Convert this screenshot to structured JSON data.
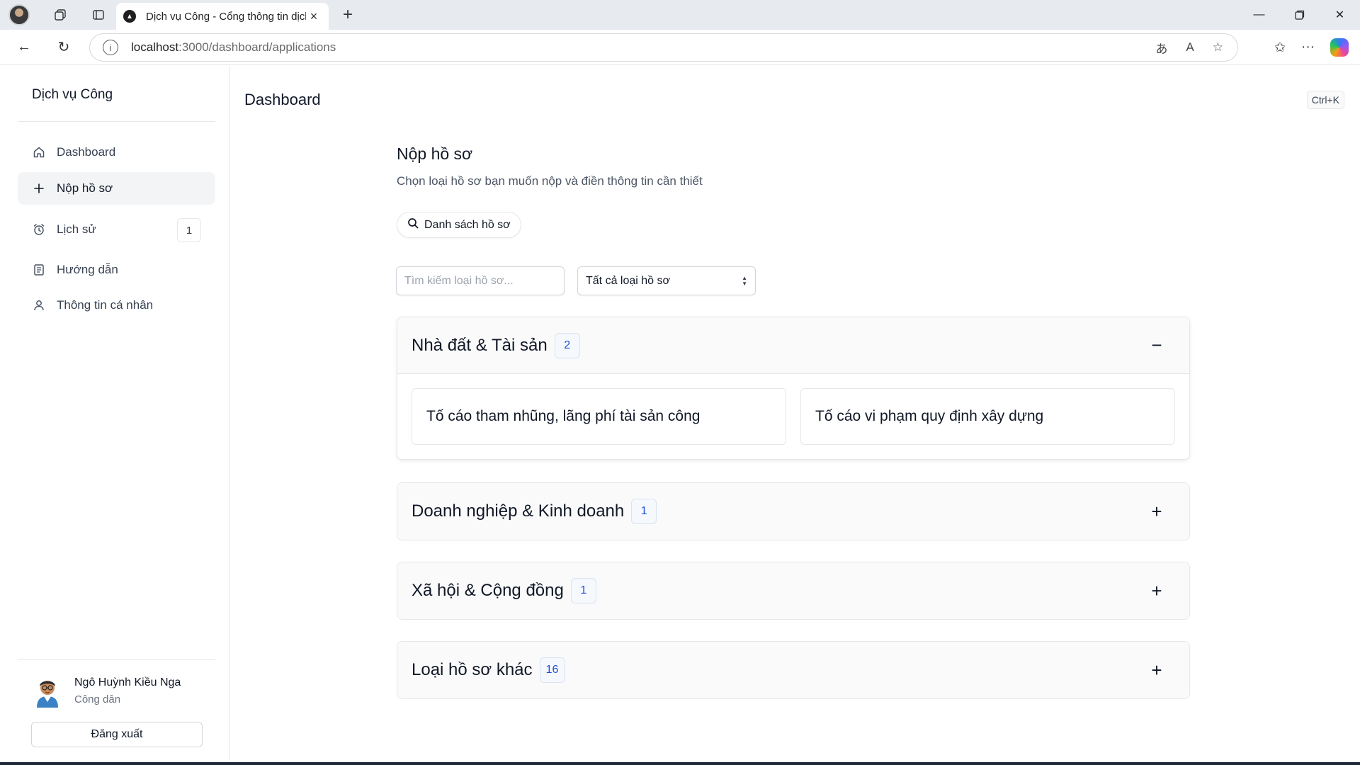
{
  "browser": {
    "tab_title": "Dịch vụ Công - Cổng thông tin dịch vụ công",
    "url_host": "localhost",
    "url_path": ":3000/dashboard/applications"
  },
  "sidebar": {
    "brand": "Dịch vụ Công",
    "items": [
      {
        "label": "Dashboard",
        "icon": "home-icon"
      },
      {
        "label": "Nộp hồ sơ",
        "icon": "plus-icon",
        "active": true
      },
      {
        "label": "Lịch sử",
        "icon": "alarm-clock-icon",
        "badge": "1"
      },
      {
        "label": "Hướng dẫn",
        "icon": "book-icon"
      },
      {
        "label": "Thông tin cá nhân",
        "icon": "user-icon"
      }
    ],
    "user": {
      "name": "Ngô Huỳnh Kiều Nga",
      "role": "Công dân"
    },
    "logout_label": "Đăng xuất"
  },
  "header": {
    "title": "Dashboard",
    "shortcut": "Ctrl+K"
  },
  "main": {
    "title": "Nộp hồ sơ",
    "subtitle": "Chọn loại hồ sơ bạn muốn nộp và điền thông tin cần thiết",
    "list_button": "Danh sách hồ sơ",
    "search_placeholder": "Tìm kiếm loại hồ sơ...",
    "type_filter": "Tất cả loại hồ sơ",
    "categories": [
      {
        "title": "Nhà đất & Tài sản",
        "count": "2",
        "toggle": "−",
        "open": true,
        "items": [
          "Tố cáo tham nhũng, lãng phí tài sản công",
          "Tố cáo vi phạm quy định xây dựng"
        ]
      },
      {
        "title": "Doanh nghiệp & Kinh doanh",
        "count": "1",
        "toggle": "+"
      },
      {
        "title": "Xã hội & Cộng đồng",
        "count": "1",
        "toggle": "+"
      },
      {
        "title": "Loại hồ sơ khác",
        "count": "16",
        "toggle": "+"
      }
    ]
  },
  "colors": {
    "accent": "#1d4ed8",
    "badge_bg": "#f5f8fd",
    "active_nav_bg": "#f3f4f6",
    "border": "#e5e7eb"
  }
}
